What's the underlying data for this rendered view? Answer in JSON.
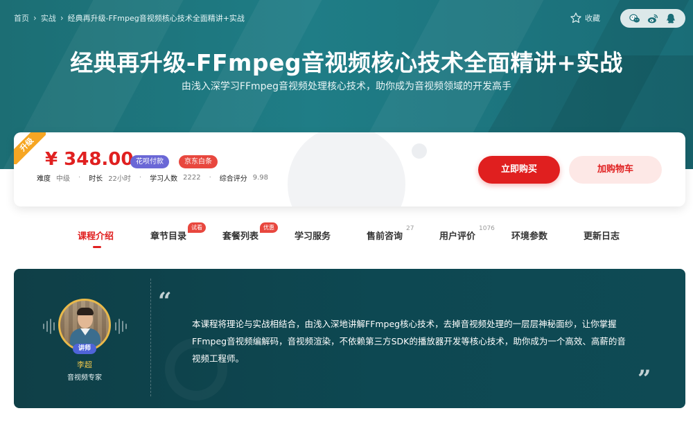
{
  "breadcrumb": {
    "items": [
      "首页",
      "实战",
      "经典再升级-FFmpeg音视频核心技术全面精讲+实战"
    ],
    "separator": "›"
  },
  "header": {
    "collect_label": "收藏",
    "share_icons": [
      "wechat-icon",
      "weibo-icon",
      "qq-icon"
    ]
  },
  "course": {
    "title": "经典再升级-FFmpeg音视频核心技术全面精讲+实战",
    "subtitle": "由浅入深学习FFmpeg音视频处理核心技术，助你成为音视频领域的开发高手"
  },
  "price_card": {
    "ribbon": "升级",
    "price": "¥ 348.00",
    "payment_badges": [
      "花呗付款",
      "京东白条"
    ],
    "stats": [
      {
        "label": "难度",
        "value": "中级"
      },
      {
        "label": "时长",
        "value": "22小时"
      },
      {
        "label": "学习人数",
        "value": "2222"
      },
      {
        "label": "综合评分",
        "value": "9.98"
      }
    ],
    "buy_label": "立即购买",
    "cart_label": "加购物车"
  },
  "tabs": [
    {
      "label": "课程介绍",
      "active": true
    },
    {
      "label": "章节目录",
      "tag": "试看"
    },
    {
      "label": "套餐列表",
      "tag": "优惠"
    },
    {
      "label": "学习服务"
    },
    {
      "label": "售前咨询",
      "count": "27"
    },
    {
      "label": "用户评价",
      "count": "1076"
    },
    {
      "label": "环境参数"
    },
    {
      "label": "更新日志"
    }
  ],
  "teacher": {
    "badge": "讲师",
    "name": "李超",
    "role": "音视频专家",
    "intro": "本课程将理论与实战相结合，由浅入深地讲解FFmpeg核心技术，去掉音视频处理的一层层神秘面纱，让你掌握FFmpeg音视频编解码，音视频渲染，不依赖第三方SDK的播放器开发等核心技术，助你成为一个高效、高薪的音视频工程师。",
    "quote_open": "“",
    "quote_close": "”"
  },
  "colors": {
    "accent_red": "#e02020",
    "banner_teal": "#1f7d86",
    "panel_dark_teal": "#0d4852",
    "huabei_purple": "#6a67d6",
    "ribbon_orange": "#f6a623"
  }
}
